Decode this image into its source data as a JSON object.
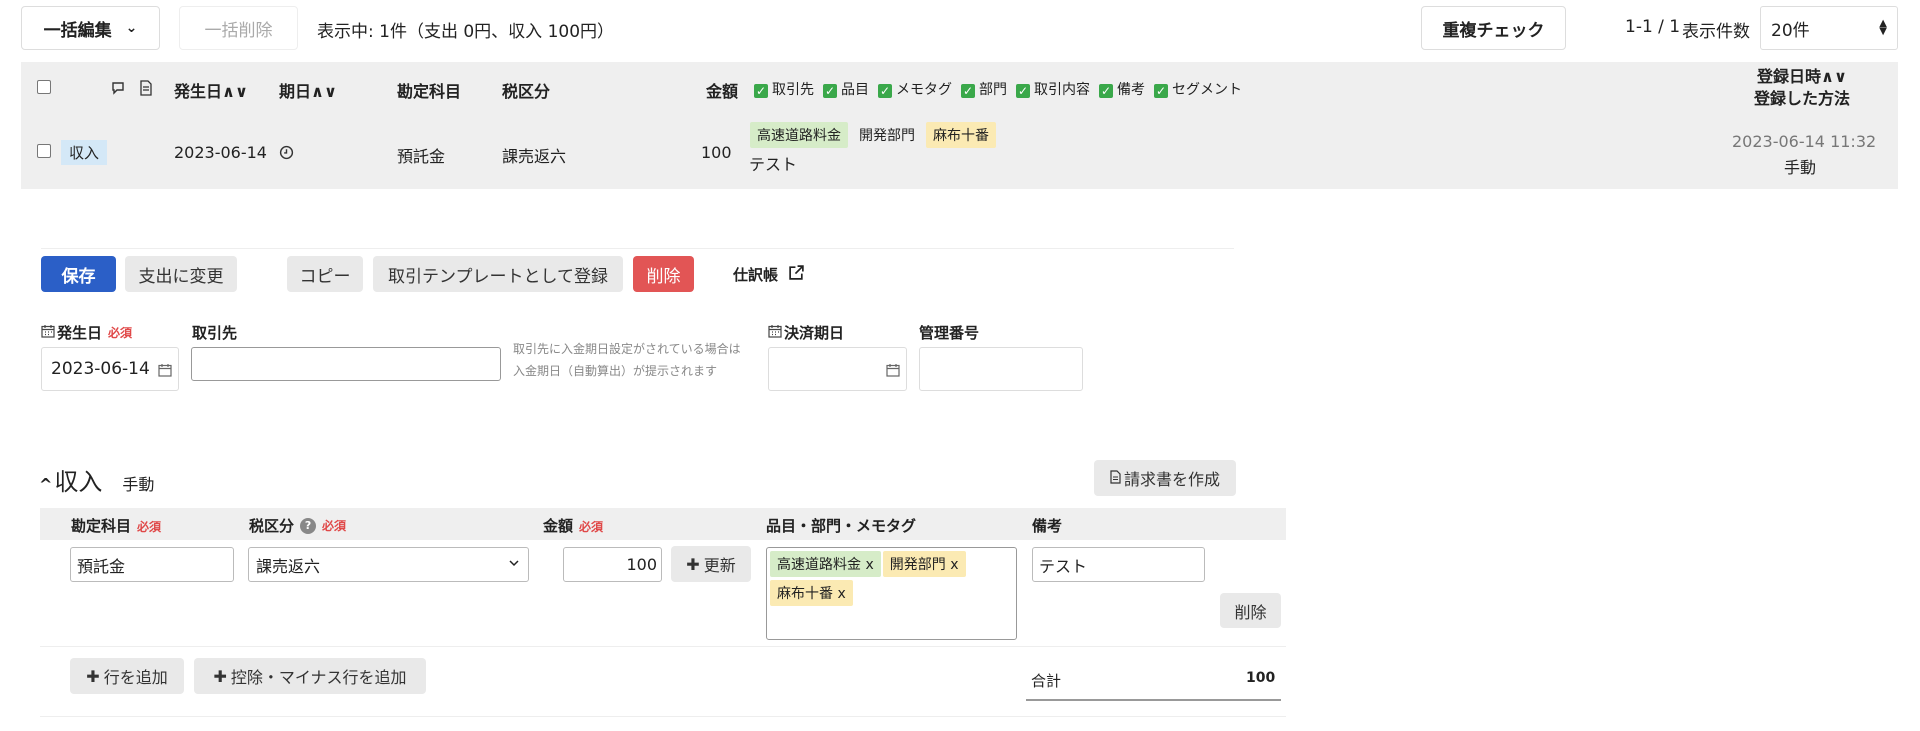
{
  "toolbar": {
    "bulk_edit": "一括編集",
    "bulk_delete": "一括削除",
    "summary": "表示中: 1件（支出 0円、収入 100円）",
    "dup_check": "重複チェック",
    "pagination": "1-1 / 1",
    "per_page_label": "表示件数",
    "per_page_value": "20件"
  },
  "table": {
    "headers": {
      "issue_date": "発生日",
      "due_date": "期日",
      "account": "勘定科目",
      "tax": "税区分",
      "amount": "金額",
      "registered_at": "登録日時",
      "registered_method": "登録した方法"
    },
    "column_toggles": [
      "取引先",
      "品目",
      "メモタグ",
      "部門",
      "取引内容",
      "備考",
      "セグメント"
    ],
    "row": {
      "type": "収入",
      "date": "2023-06-14",
      "account": "預託金",
      "tax": "課売返六",
      "amount": "100",
      "tags": [
        "高速道路料金",
        "開発部門",
        "麻布十番"
      ],
      "memo": "テスト",
      "registered_at": "2023-06-14 11:32",
      "method": "手動"
    }
  },
  "form": {
    "save": "保存",
    "change_to_expense": "支出に変更",
    "copy": "コピー",
    "register_template": "取引テンプレートとして登録",
    "delete": "削除",
    "journal": "仕訳帳",
    "issue_date_label": "発生日",
    "required": "必須",
    "issue_date_value": "2023-06-14",
    "partner_label": "取引先",
    "partner_value": "",
    "partner_hint_1": "取引先に入金期日設定がされている場合は",
    "partner_hint_2": "入金期日（自動算出）が提示されます",
    "settlement_label": "決済期日",
    "mgmt_no_label": "管理番号"
  },
  "income": {
    "title": "収入",
    "method": "手動",
    "invoice": "請求書を作成",
    "headers": {
      "account": "勘定科目",
      "tax": "税区分",
      "amount": "金額",
      "tags": "品目・部門・メモタグ",
      "memo": "備考"
    },
    "row": {
      "account": "預託金",
      "tax": "課売返六",
      "amount": "100",
      "update": "更新",
      "tags": [
        "高速道路料金",
        "開発部門",
        "麻布十番"
      ],
      "tag_remove": "x",
      "memo": "テスト",
      "delete": "削除"
    },
    "add_row": "行を追加",
    "add_deduction": "控除・マイナス行を追加",
    "total_label": "合計",
    "total_value": "100"
  },
  "colors": {
    "primary": "#2b5fc7",
    "danger": "#e25555",
    "tag_green": "#d6ecc8",
    "tag_yellow": "#fbeab3",
    "check_green": "#3aa84a"
  }
}
